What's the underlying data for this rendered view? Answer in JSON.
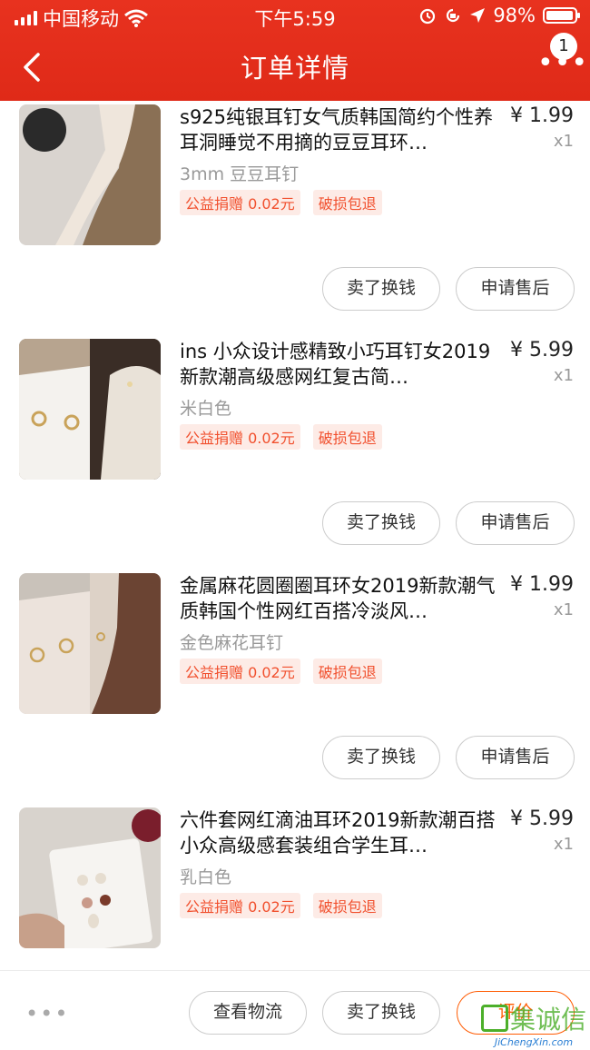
{
  "status_bar": {
    "carrier": "中国移动",
    "time": "下午5:59",
    "battery": "98%",
    "battery_level": 0.98
  },
  "nav": {
    "title": "订单详情",
    "badge": "1",
    "back_icon": "chevron-left-icon",
    "more_icon": "more-dots-icon"
  },
  "items": [
    {
      "name": "s925纯银耳钉女气质韩国简约个性养耳洞睡觉不用摘的豆豆耳环…",
      "price": "¥ 1.99",
      "qty": "x1",
      "spec": "3mm 豆豆耳钉",
      "tags": [
        "公益捐赠 0.02元",
        "破损包退"
      ],
      "buttons": [
        "卖了换钱",
        "申请售后"
      ]
    },
    {
      "name": "ins 小众设计感精致小巧耳钉女2019新款潮高级感网红复古简…",
      "price": "¥ 5.99",
      "qty": "x1",
      "spec": "米白色",
      "tags": [
        "公益捐赠 0.02元",
        "破损包退"
      ],
      "buttons": [
        "卖了换钱",
        "申请售后"
      ]
    },
    {
      "name": "金属麻花圆圈圈耳环女2019新款潮气质韩国个性网红百搭冷淡风…",
      "price": "¥ 1.99",
      "qty": "x1",
      "spec": "金色麻花耳钉",
      "tags": [
        "公益捐赠 0.02元",
        "破损包退"
      ],
      "buttons": [
        "卖了换钱",
        "申请售后"
      ]
    },
    {
      "name": "六件套网红滴油耳环2019新款潮百搭小众高级感套装组合学生耳…",
      "price": "¥ 5.99",
      "qty": "x1",
      "spec": "乳白色",
      "tags": [
        "公益捐赠 0.02元",
        "破损包退"
      ],
      "buttons": []
    }
  ],
  "footer": {
    "more": "•••",
    "logistics": "查看物流",
    "sell": "卖了换钱",
    "review": "评价"
  },
  "watermark": {
    "text": "集诚信",
    "url": "JiChengXin.com"
  },
  "colors": {
    "header": "#e2301c",
    "tag_text": "#f1502e",
    "tag_bg": "#fdebe6",
    "review_btn": "#ff5a00"
  }
}
